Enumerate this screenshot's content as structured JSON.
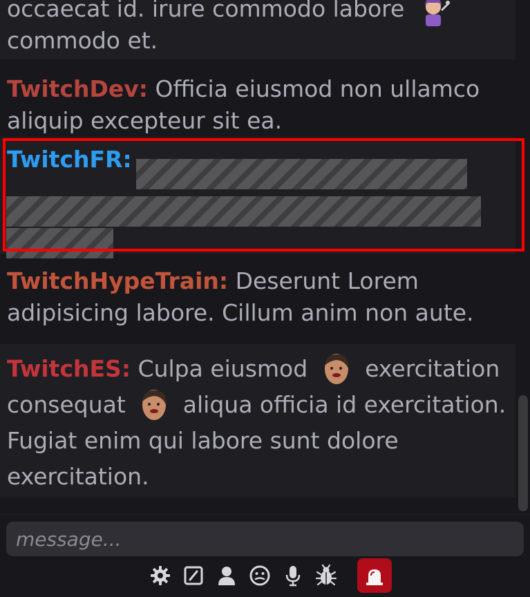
{
  "chat": {
    "messages": [
      {
        "user": "",
        "text_line1": "occaecat id. irure commodo labore",
        "text_line2": "commodo et.",
        "user_color": "#9147ff",
        "emote": "dev-emote"
      },
      {
        "user": "TwitchDev:",
        "text": "Officia eiusmod non ullamco aliquip excepteur sit ea.",
        "user_color": "#b5453d"
      },
      {
        "user": "TwitchFR:",
        "text": "",
        "user_color": "#2e9cf0",
        "redacted": true,
        "highlighted": true
      },
      {
        "user": "TwitchHypeTrain:",
        "text": "Deserunt Lorem adipisicing labore. Cillum anim non aute.",
        "user_color": "#c2543b"
      },
      {
        "user": "TwitchES:",
        "text_part1": "Culpa eiusmod",
        "text_part2": "exercitation consequat",
        "text_part3": "aliqua officia id exercitation. Fugiat enim qui labore sunt dolore exercitation.",
        "user_color": "#c4343b",
        "emote": "face-emote"
      }
    ]
  },
  "input": {
    "placeholder": "message..."
  },
  "toolbar": {
    "icons": [
      "gear-icon",
      "slash-command-icon",
      "user-icon",
      "emoji-icon",
      "microphone-icon",
      "bug-icon",
      "alarm-icon"
    ],
    "alarm_color": "#b00c19"
  },
  "colors": {
    "background": "#18171c",
    "alt_row": "#1f1f23",
    "text": "#adadb8",
    "highlight_border": "#ff0000"
  }
}
